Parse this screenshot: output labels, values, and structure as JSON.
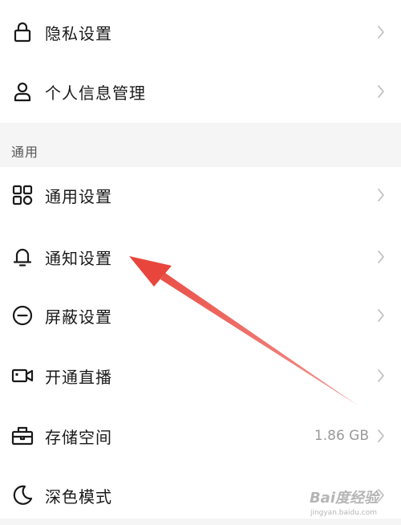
{
  "items_top": [
    {
      "label": "隐私设置",
      "icon": "lock-icon"
    },
    {
      "label": "个人信息管理",
      "icon": "person-icon"
    }
  ],
  "section": {
    "label": "通用"
  },
  "items_general": [
    {
      "label": "通用设置",
      "icon": "grid-icon"
    },
    {
      "label": "通知设置",
      "icon": "bell-icon"
    },
    {
      "label": "屏蔽设置",
      "icon": "block-icon"
    },
    {
      "label": "开通直播",
      "icon": "video-camera-icon"
    },
    {
      "label": "存储空间",
      "icon": "storage-icon",
      "value": "1.86 GB"
    },
    {
      "label": "深色模式",
      "icon": "moon-icon"
    }
  ],
  "annotation": {
    "color": "#e8453c",
    "points_to": "通知设置"
  },
  "watermark": {
    "brand": "Bai",
    "paw": "度",
    "suffix": "经验",
    "url": "jingyan.baidu.com"
  }
}
